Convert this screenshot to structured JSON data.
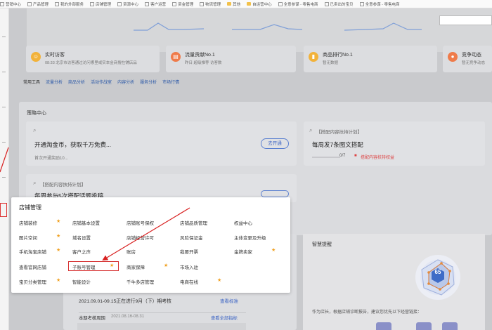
{
  "bookmarks": [
    "营销中心",
    "产品管理",
    "我的外部服务",
    "店铺管理",
    "资源中心",
    "客户运营",
    "资金管理",
    "物流管理",
    "其他",
    "自运营中心",
    "全意参谋 - 零售电商",
    "已卖出的宝贝",
    "全意参谋 - 零售电商"
  ],
  "cards": [
    {
      "title": "实时访客",
      "sub": "08:33 北京市访客通过访问哪里或实本金商搜在铺店品",
      "icon": "user-icon",
      "color": "#f2b23a"
    },
    {
      "title": "流量贡献No.1",
      "sub": "昨日 超级推荐 访客数",
      "icon": "traffic-icon",
      "color": "#ef7b4a"
    },
    {
      "title": "商品排行No.1",
      "sub": "暂无数据",
      "icon": "bar-icon",
      "color": "#f2b23a"
    },
    {
      "title": "竞争动态",
      "sub": "暂无竞争动态",
      "icon": "drop-icon",
      "color": "#ef7b4a"
    }
  ],
  "tools": [
    "常用工具",
    "流量分析",
    "商品分析",
    "活动作战室",
    "内容分析",
    "服务分析",
    "市场行情"
  ],
  "strategy": {
    "title": "策略中心",
    "card1_title": "开通淘金币，获取千万免费...",
    "card1_sub": "首次开通奖励10...",
    "card1_btn": "去开通",
    "card2_tag": "【搭配内容扶持计划】",
    "card2_title": "每周发7条图文搭配",
    "card2_progress": "0/7",
    "card2_reward": "搭配内容扶持权益",
    "card2_progress_value": 0,
    "card3_tag": "【搭配内容扶持计划】",
    "card3_title": "每周参与5次搭配话题投稿"
  },
  "menu": {
    "title": "店铺管理",
    "col1": [
      "店铺装修",
      "图片空间",
      "手机淘宝店铺",
      "查看官网店铺",
      "宝贝分类管理"
    ],
    "col2": [
      "店铺基本设置",
      "域名设置",
      "客户之声",
      "子账号管理",
      "智能设计"
    ],
    "col3": [
      "店铺账号保权",
      "店铺经营许可",
      "账房",
      "商家保障",
      "千牛多店管理"
    ],
    "col4": [
      "店铺品质管理",
      "风险保证金",
      "我要开票",
      "市场入驻",
      "电商在线"
    ],
    "col5": [
      "权益中心",
      "主体变更及升级",
      "金牌卖家",
      "",
      ""
    ]
  },
  "period": {
    "line1": "2021.09.01-09.15正在进行9月（下）期考核",
    "link1": "查看标准",
    "line2_label": "本期考核周期",
    "line2_date": "2021.08.16-08.31",
    "link2": "查看全部指标"
  },
  "smart": {
    "title": "智慧提醒",
    "score": "65",
    "desc": "作为店长，根据店铺诊断报告，建议您优先以下经营链接："
  }
}
